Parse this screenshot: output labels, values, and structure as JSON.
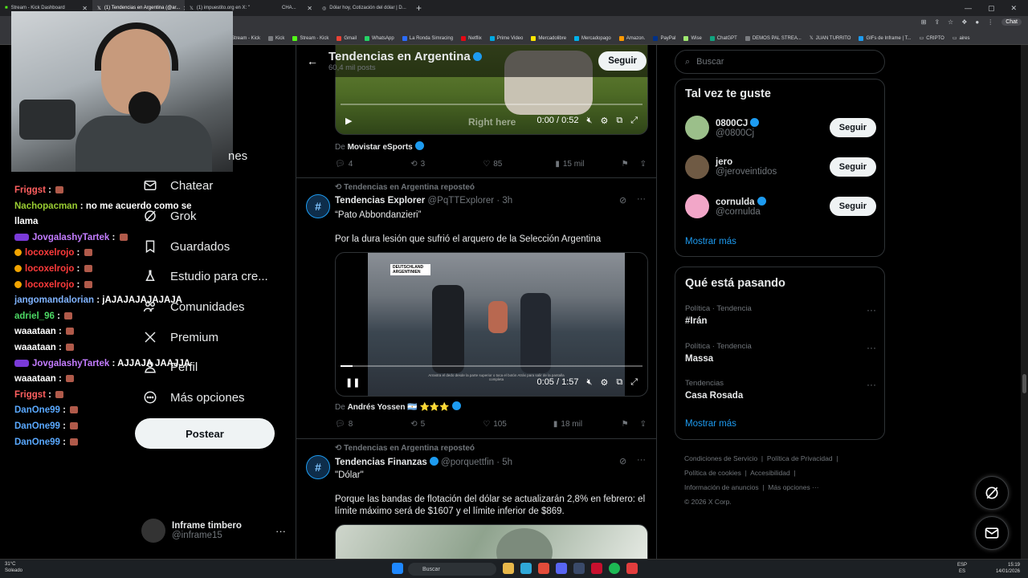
{
  "browser": {
    "tabs": [
      {
        "label": "Stream - Kick Dashboard",
        "active": false
      },
      {
        "label": "(1) Tendencias en Argentina (@ar...",
        "active": true
      },
      {
        "label": "(1) impuestito.org en X: \"",
        "active": false
      },
      {
        "label": "CHA...",
        "active": false
      },
      {
        "label": "Dólar hoy, Cotización del dólar | D...",
        "active": false
      }
    ],
    "new_tab": "+",
    "chat_label": "Chat",
    "bookmarks": [
      "Stream - Kick",
      "Kick",
      "Stream - Kick",
      "Gmail",
      "WhatsApp",
      "La Ronda Simracing",
      "Netflix",
      "Prime Video",
      "Mercadolibre",
      "Mercadopago",
      "Amazon.",
      "PayPal",
      "Wise",
      "ChatGPT",
      "DEMOS PAL STREA...",
      "JUAN TURRITO",
      "GIFs de Inframe | T...",
      "CRIPTO",
      "aires"
    ]
  },
  "chat": [
    {
      "user": "Friggst",
      "color": "#ff5f5f",
      "msg": "",
      "emote": true
    },
    {
      "user": "Nachopacman",
      "color": "#9acd32",
      "msg": "no me acuerdo como se",
      "emote": false
    },
    {
      "user": "",
      "color": "#fff",
      "msg": "llama",
      "emote": false
    },
    {
      "user": "JovgalashyTartek",
      "color": "#c37cff",
      "msg": "",
      "emote": true,
      "badge": "purple"
    },
    {
      "user": "locoxelrojo",
      "color": "#ff3b3b",
      "msg": "",
      "emote": true,
      "badge": "gold"
    },
    {
      "user": "locoxelrojo",
      "color": "#ff3b3b",
      "msg": "",
      "emote": true,
      "badge": "gold"
    },
    {
      "user": "locoxelrojo",
      "color": "#ff3b3b",
      "msg": "",
      "emote": true,
      "badge": "gold"
    },
    {
      "user": "jangomandalorian",
      "color": "#7fb3ff",
      "msg": "jAJAJAJAJAJAJA",
      "emote": false
    },
    {
      "user": "adriel_96",
      "color": "#4cd964",
      "msg": "",
      "emote": true
    },
    {
      "user": "waaataan",
      "color": "#ffffff",
      "msg": "",
      "emote": true
    },
    {
      "user": "waaataan",
      "color": "#ffffff",
      "msg": "",
      "emote": true
    },
    {
      "user": "JovgalashyTartek",
      "color": "#c37cff",
      "msg": "AJJAJA JAAJJA",
      "emote": false,
      "badge": "purple"
    },
    {
      "user": "waaataan",
      "color": "#ffffff",
      "msg": "",
      "emote": true
    },
    {
      "user": "Friggst",
      "color": "#ff5f5f",
      "msg": "",
      "emote": true
    },
    {
      "user": "DanOne99",
      "color": "#5aa9ff",
      "msg": "",
      "emote": true
    },
    {
      "user": "DanOne99",
      "color": "#5aa9ff",
      "msg": "",
      "emote": true
    },
    {
      "user": "DanOne99",
      "color": "#5aa9ff",
      "msg": "",
      "emote": true
    }
  ],
  "nav": {
    "partial_label": "nes",
    "items": [
      {
        "label": "Chatear",
        "icon": "mail-icon"
      },
      {
        "label": "Grok",
        "icon": "grok-icon"
      },
      {
        "label": "Guardados",
        "icon": "bookmark-icon"
      },
      {
        "label": "Estudio para cre...",
        "icon": "flask-icon"
      },
      {
        "label": "Comunidades",
        "icon": "people-icon"
      },
      {
        "label": "Premium",
        "icon": "x-logo-icon"
      },
      {
        "label": "Perfil",
        "icon": "person-icon"
      },
      {
        "label": "Más opciones",
        "icon": "more-icon"
      }
    ],
    "post_label": "Postear",
    "account": {
      "name": "Inframe timbero",
      "handle": "@inframe15"
    }
  },
  "feed": {
    "header": {
      "title": "Tendencias en Argentina",
      "subtitle": "60,4 mil posts",
      "follow": "Seguir"
    },
    "video1": {
      "overlay": "Right here",
      "time": "0:00 / 0:52",
      "progress": 0.0
    },
    "source1": {
      "prefix": "De",
      "name": "Movistar eSports"
    },
    "actions1": {
      "replies": "4",
      "reposts": "3",
      "likes": "85",
      "views": "15 mil"
    },
    "tweet2": {
      "repost_note": "Tendencias en Argentina reposteó",
      "name": "Tendencias Explorer",
      "handle": "@PqTTExplorer",
      "time": "· 3h",
      "text1": "“Pato Abbondanzieri”",
      "text2": "Por la dura lesión que sufrió el arquero de la Selección Argentina",
      "video_score": "DEUTSCHLAND ARGENTINIEN",
      "video_hint": "Arrastra el dedo desde la parte superior o toca el botón Atrás para salir de la pantalla completa",
      "time_code": "0:05 / 1:57",
      "progress": 0.04,
      "source_prefix": "De",
      "source_name": "Andrés Yossen 🇦🇷 ⭐⭐⭐",
      "replies": "8",
      "reposts": "5",
      "likes": "105",
      "views": "18 mil"
    },
    "tweet3": {
      "repost_note": "Tendencias en Argentina reposteó",
      "name": "Tendencias Finanzas",
      "handle": "@porquettfin",
      "time": "· 5h",
      "text1": "\"Dólar\"",
      "text2": "Porque las bandas de flotación del dólar se actualizarán 2,8% en febrero: el límite máximo será de $1607 y el límite inferior de $869."
    }
  },
  "sidebar": {
    "search_placeholder": "Buscar",
    "suggest_title": "Tal vez te guste",
    "suggestions": [
      {
        "name": "0800CJ",
        "handle": "@0800Cj",
        "verified": true,
        "follow": "Seguir"
      },
      {
        "name": "jero",
        "handle": "@jeroveintidos",
        "verified": false,
        "follow": "Seguir"
      },
      {
        "name": "cornulda",
        "handle": "@cornulda",
        "verified": true,
        "follow": "Seguir"
      }
    ],
    "show_more": "Mostrar más",
    "trending_title": "Qué está pasando",
    "trends": [
      {
        "category": "Política · Tendencia",
        "name": "#Irán"
      },
      {
        "category": "Política · Tendencia",
        "name": "Massa"
      },
      {
        "category": "Tendencias",
        "name": "Casa Rosada"
      }
    ],
    "trends_more": "Mostrar más",
    "footer": {
      "l1a": "Condiciones de Servicio",
      "l1b": "Política de Privacidad",
      "l2a": "Política de cookies",
      "l2b": "Accesibilidad",
      "l3a": "Información de anuncios",
      "l3b": "Más opciones ···",
      "copyright": "© 2026 X Corp."
    }
  },
  "taskbar": {
    "weather_temp": "31°C",
    "weather_desc": "Soleado",
    "search": "Buscar",
    "lang1": "ESP",
    "lang2": "ES",
    "time": "15:19",
    "date": "14/01/2026"
  },
  "colors": {
    "accent": "#1d9bf0",
    "bg": "#000000",
    "border": "#2f3336",
    "muted": "#71767b"
  }
}
